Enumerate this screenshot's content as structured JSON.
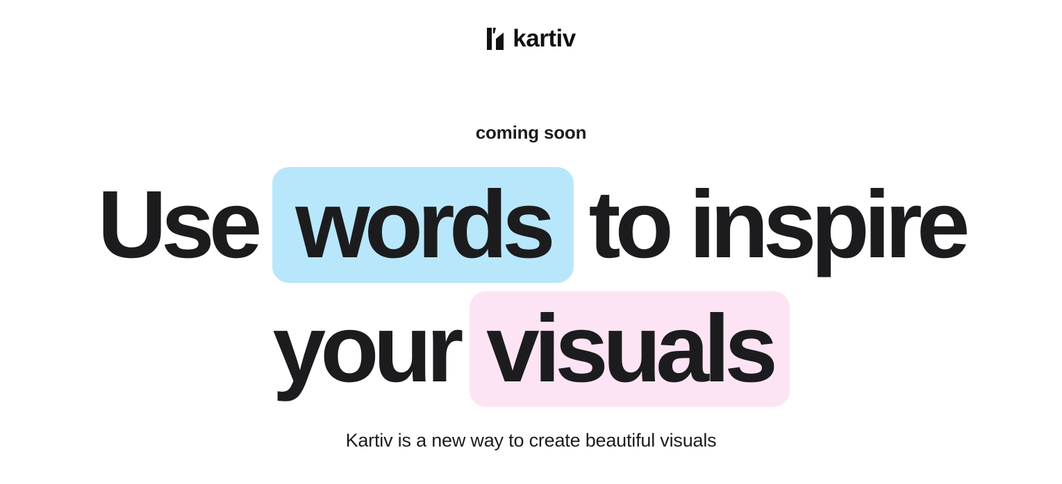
{
  "brand": {
    "name": "kartiv",
    "logo_icon": "kartiv-logo-mark-icon"
  },
  "hero": {
    "eyebrow": "coming soon",
    "headline": {
      "line1": [
        "Use",
        "words",
        "to inspire"
      ],
      "line2": [
        "your",
        "visuals"
      ]
    },
    "subtitle": "Kartiv is a new way to create beautiful visuals"
  },
  "colors": {
    "text": "#1c1c1e",
    "highlight_blue": "#b8e7fb",
    "highlight_pink": "#fce4f4",
    "background": "#ffffff"
  }
}
